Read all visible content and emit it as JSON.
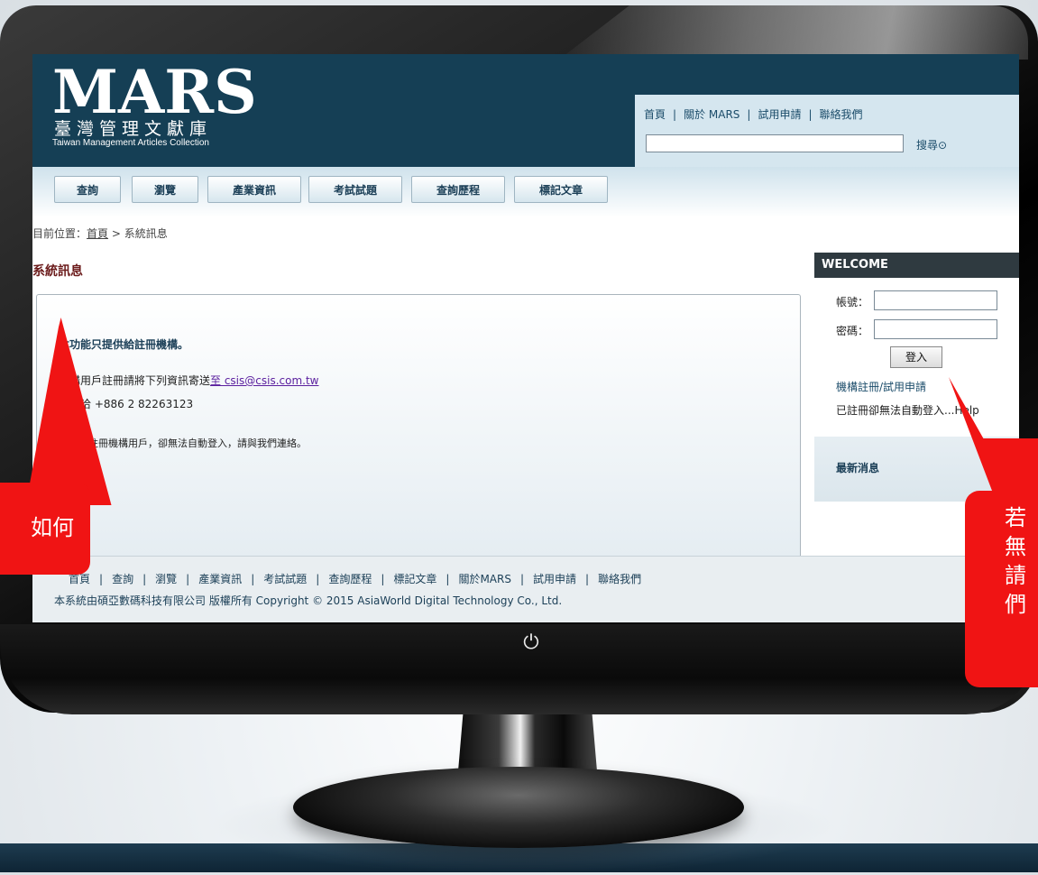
{
  "header": {
    "logo_main": "MARS",
    "logo_cn": "臺灣管理文獻庫",
    "logo_en": "Taiwan Management Articles Collection",
    "top_nav": [
      "首頁",
      "關於 MARS",
      "試用申請",
      "聯絡我們"
    ],
    "search_button": "搜尋",
    "search_value": ""
  },
  "tabs": [
    "查詢",
    "瀏覽",
    "產業資訊",
    "考試試題",
    "查詢歷程",
    "標記文章"
  ],
  "breadcrumb": {
    "prefix": "目前位置：",
    "home": "首頁",
    "current": " > 系統訊息"
  },
  "page_title": "系統訊息",
  "notice": {
    "title": "本功能只提供給註冊機構。",
    "line1_text": "機構用戶註冊請將下列資訊寄送",
    "line1_link": "至 csis@csis.com.tw",
    "line2": "或電洽 +886 2 82263123",
    "line3": "若您為註冊機構用戶，卻無法自動登入，請與我們連絡。"
  },
  "sidebar": {
    "welcome": "WELCOME",
    "account_label": "帳號：",
    "password_label": "密碼：",
    "login_button": "登入",
    "register_link": "機構註冊/試用申請",
    "note": "已註冊卻無法自動登入...Help",
    "news_title": "最新消息"
  },
  "footer": {
    "links": [
      "首頁",
      "查詢",
      "瀏覽",
      "產業資訊",
      "考試試題",
      "查詢歷程",
      "標記文章",
      "關於MARS",
      "試用申請",
      "聯絡我們"
    ],
    "copyright": "本系統由碩亞數碼科技有限公司 版權所有 Copyright © 2015 AsiaWorld Digital Technology Co., Ltd."
  },
  "callouts": {
    "left_text": "如何",
    "right_lines": [
      "若",
      "無",
      "請",
      "們"
    ]
  },
  "colors": {
    "header_bg": "#153f55",
    "callout": "#f01414",
    "title_color": "#6b1b1b"
  }
}
